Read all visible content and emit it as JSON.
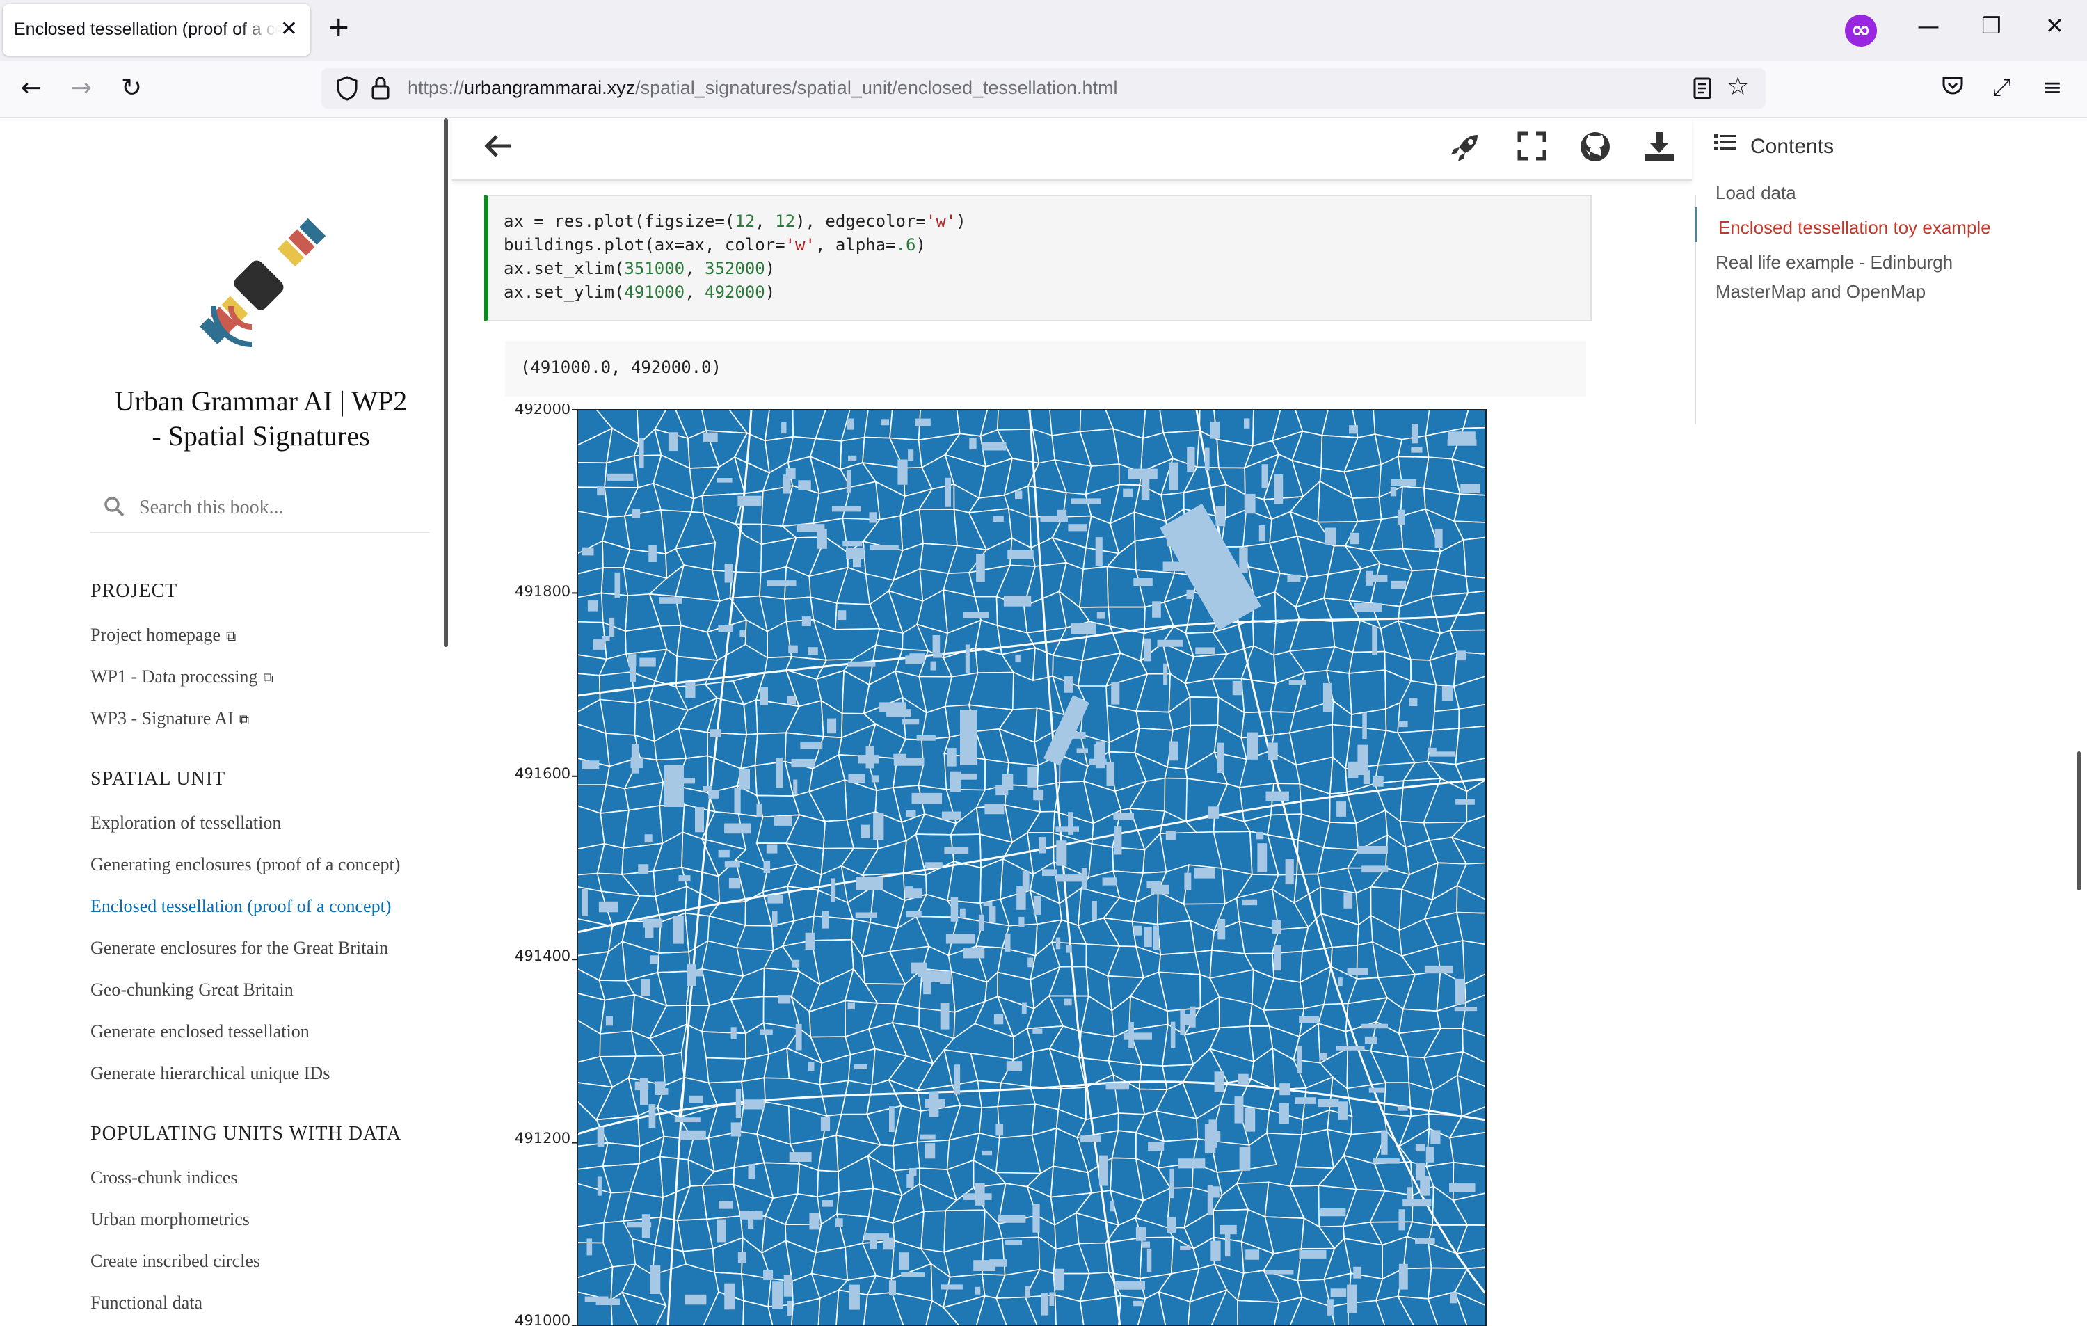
{
  "browser": {
    "tab_title": "Enclosed tessellation (proof of a concept)",
    "tab_close": "✕",
    "new_tab": "+",
    "url_prefix": "https://",
    "url_host": "urbangrammarai.xyz",
    "url_path": "/spatial_signatures/spatial_unit/enclosed_tessellation.html",
    "icons": [
      "back-arrow",
      "forward-arrow",
      "reload",
      "shield",
      "lock",
      "reader-view",
      "bookmark-star",
      "pocket",
      "fullscreen",
      "menu"
    ],
    "win_minimize": "—",
    "win_restore": "❐",
    "win_close": "✕"
  },
  "sidebar": {
    "title_line1": "Urban Grammar AI | WP2",
    "title_line2": "- Spatial Signatures",
    "search_placeholder": "Search this book...",
    "sections": [
      {
        "title": "PROJECT",
        "items": [
          "Project homepage",
          "WP1 - Data processing",
          "WP3 - Signature AI"
        ]
      },
      {
        "title": "SPATIAL UNIT",
        "items": [
          "Exploration of tessellation",
          "Generating enclosures (proof of a concept)",
          "Enclosed tessellation (proof of a concept)",
          "Generate enclosures for the Great Britain",
          "Geo-chunking Great Britain",
          "Generate enclosed tessellation",
          "Generate hierarchical unique IDs"
        ]
      },
      {
        "title": "POPULATING UNITS WITH DATA",
        "items": [
          "Cross-chunk indices",
          "Urban morphometrics",
          "Create inscribed circles",
          "Functional data"
        ]
      }
    ],
    "logo_colors": [
      "#2f6f8f",
      "#c95b4f",
      "#e8c34a",
      "#2e2e2e"
    ]
  },
  "header": {
    "icons": [
      "back-arrow-icon",
      "rocket-icon",
      "fullscreen-icon",
      "github-icon",
      "download-icon"
    ]
  },
  "code": {
    "line1": [
      "ax = res.plot(figsize=(",
      "12",
      ", ",
      "12",
      "), edgecolor=",
      "'w'",
      ")"
    ],
    "line2": [
      "buildings.plot(ax=ax, color=",
      "'w'",
      ", alpha=",
      ".6",
      ")"
    ],
    "line3": [
      "ax.set_xlim(",
      "351000",
      ", ",
      "352000",
      ")"
    ],
    "line4": [
      "ax.set_ylim(",
      "491000",
      ", ",
      "492000",
      ")"
    ]
  },
  "output": "(491000.0, 492000.0)",
  "chart_data": {
    "type": "map",
    "ylim": [
      491000,
      492000
    ],
    "xlim": [
      351000,
      352000
    ],
    "yticks": [
      "492000",
      "491800",
      "491600",
      "491400",
      "491200",
      "491000"
    ],
    "fill_color": "#1f77b4",
    "edge_color": "#ffffff",
    "building_color": "#a6c8e4"
  },
  "toc": {
    "heading": "Contents",
    "items": [
      "Load data",
      "Enclosed tessellation toy example",
      "Real life example - Edinburgh",
      "MasterMap and OpenMap"
    ]
  }
}
